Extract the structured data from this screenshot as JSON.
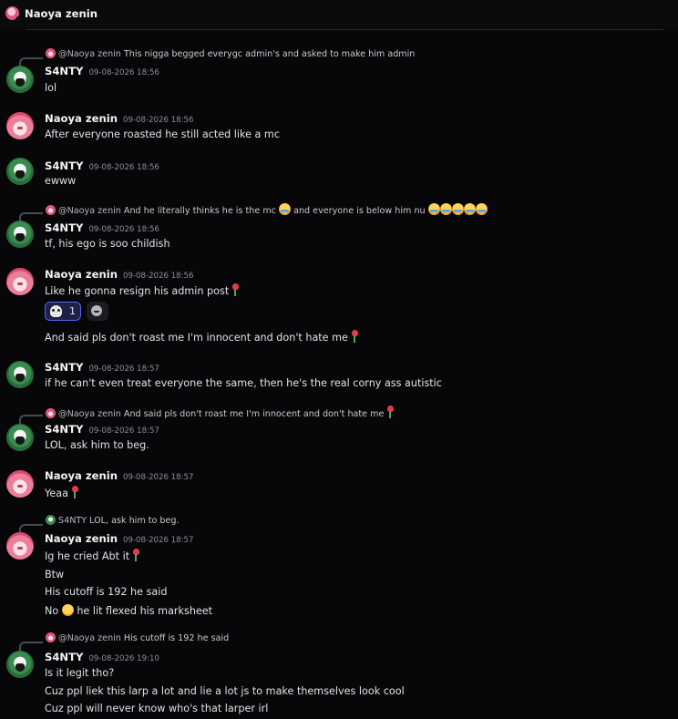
{
  "header": {
    "title": "Naoya zenin"
  },
  "messages": [
    {
      "reply_to": "@Naoya zenin",
      "reply_text": "This nigga begged everygc admin's and asked to make him admin",
      "author": "S4NTY",
      "time": "09-08-2026 18:56",
      "lines": [
        "lol"
      ]
    },
    {
      "author": "Naoya zenin",
      "time": "09-08-2026 18:56",
      "lines": [
        "After everyone roasted he still acted like a mc"
      ]
    },
    {
      "author": "S4NTY",
      "time": "09-08-2026 18:56",
      "lines": [
        "ewww"
      ]
    },
    {
      "reply_to": "@Naoya zenin",
      "reply_text": "And he literally thinks he is the mc",
      "reply_text_2": "and everyone is below him nu",
      "author": "S4NTY",
      "time": "09-08-2026 18:56",
      "lines": [
        "tf, his ego is soo childish"
      ]
    },
    {
      "author": "Naoya zenin",
      "time": "09-08-2026 18:56",
      "lines": [
        "Like he gonna resign his admin post",
        "And said pls don't roast me I'm innocent and don't hate me"
      ],
      "reaction_count": "1"
    },
    {
      "author": "S4NTY",
      "time": "09-08-2026 18:57",
      "lines": [
        "if he can't even treat everyone the same, then he's the real corny ass autistic"
      ]
    },
    {
      "reply_to": "@Naoya zenin",
      "reply_text": "And said pls don't roast me I'm innocent and don't hate me",
      "author": "S4NTY",
      "time": "09-08-2026 18:57",
      "lines": [
        "LOL, ask him to beg."
      ]
    },
    {
      "author": "Naoya zenin",
      "time": "09-08-2026 18:57",
      "lines": [
        "Yeaa"
      ]
    },
    {
      "reply_to": "S4NTY",
      "reply_text": "LOL, ask him to beg.",
      "author": "Naoya zenin",
      "time": "09-08-2026 18:57",
      "lines": [
        "Ig he cried Abt it",
        "Btw",
        "His cutoff is 192 he said",
        "No",
        "he lit flexed his marksheet"
      ]
    },
    {
      "reply_to": "@Naoya zenin",
      "reply_text": "His cutoff is 192 he said",
      "author": "S4NTY",
      "time": "09-08-2026 19:10",
      "lines": [
        "Is it legit tho?",
        "Cuz ppl liek this larp a lot and lie a lot js to make themselves look cool",
        "Cuz ppl will never know who's that larper irl"
      ]
    }
  ],
  "icons": {
    "skull": "skull-emoji-icon",
    "add_reaction": "add-reaction-icon",
    "rose": "wilted-rose-emoji-icon",
    "cry": "loudly-crying-emoji-icon",
    "think": "thinking-emoji-icon"
  }
}
